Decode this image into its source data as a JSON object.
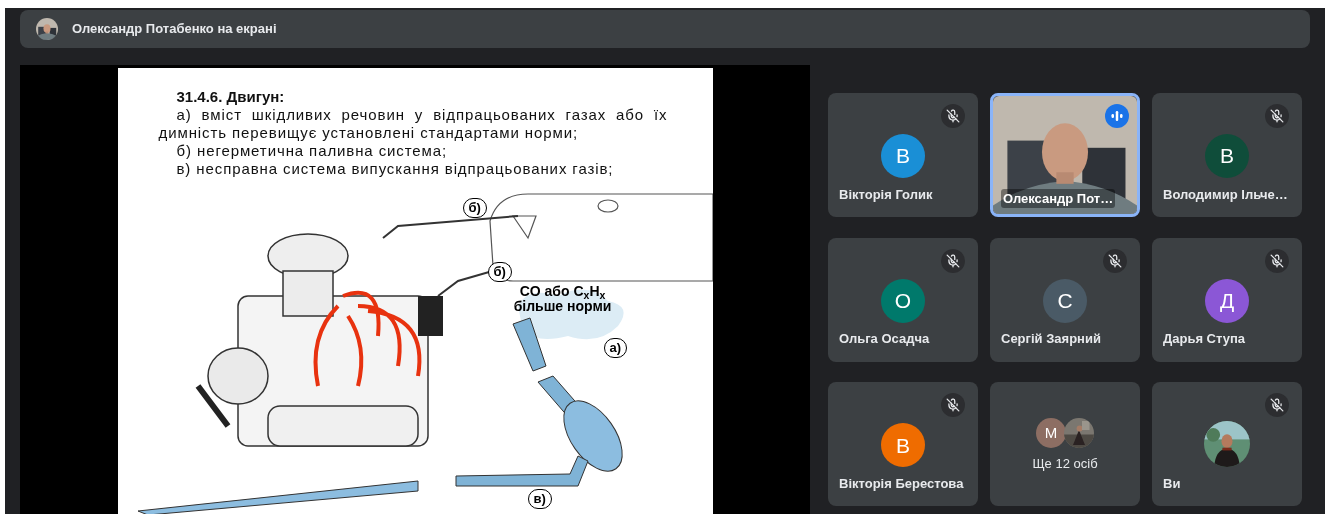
{
  "header": {
    "title": "Олександр Потабенко на екрані"
  },
  "slide": {
    "heading": "31.4.6. Двигун:",
    "items": [
      "а) вміст шкідливих речовин у відпрацьованих газах або їх димність перевищує установлені стандартами норми;",
      "б) негерметична паливна система;",
      "в) несправна система випускання відпрацьованих газів;"
    ],
    "figure_labels": [
      {
        "kind": "callout",
        "text": "б)"
      },
      {
        "kind": "callout",
        "text": "б)"
      },
      {
        "kind": "caption",
        "text": "CO або C$_{x}$H$_{x}$ більше норми"
      },
      {
        "kind": "callout",
        "text": "а)"
      },
      {
        "kind": "callout",
        "text": "в)"
      }
    ]
  },
  "participants": [
    {
      "kind": "avatar",
      "name": "Вікторія Голик",
      "initial": "В",
      "color": "#1a8fd6",
      "muted": true,
      "speaking": false
    },
    {
      "kind": "video",
      "name": "Олександр Пот…",
      "muted": false,
      "speaking": true
    },
    {
      "kind": "avatar",
      "name": "Володимир Ільче…",
      "initial": "В",
      "color": "#0f4d3a",
      "muted": true,
      "speaking": false
    },
    {
      "kind": "avatar",
      "name": "Ольга Осадча",
      "initial": "О",
      "color": "#00796b",
      "muted": true,
      "speaking": false
    },
    {
      "kind": "avatar",
      "name": "Сергій Заярний",
      "initial": "С",
      "color": "#4a5a66",
      "muted": true,
      "speaking": false
    },
    {
      "kind": "avatar",
      "name": "Дарья Ступа",
      "initial": "Д",
      "color": "#8b57d6",
      "muted": true,
      "speaking": false
    },
    {
      "kind": "avatar",
      "name": "Вікторія Берестова",
      "initial": "В",
      "color": "#ef6c00",
      "muted": true,
      "speaking": false
    },
    {
      "kind": "others",
      "label": "Ще 12 осіб",
      "initial": "М",
      "color": "#8d6e63"
    },
    {
      "kind": "self",
      "name": "Ви",
      "muted": true,
      "speaking": false
    }
  ]
}
